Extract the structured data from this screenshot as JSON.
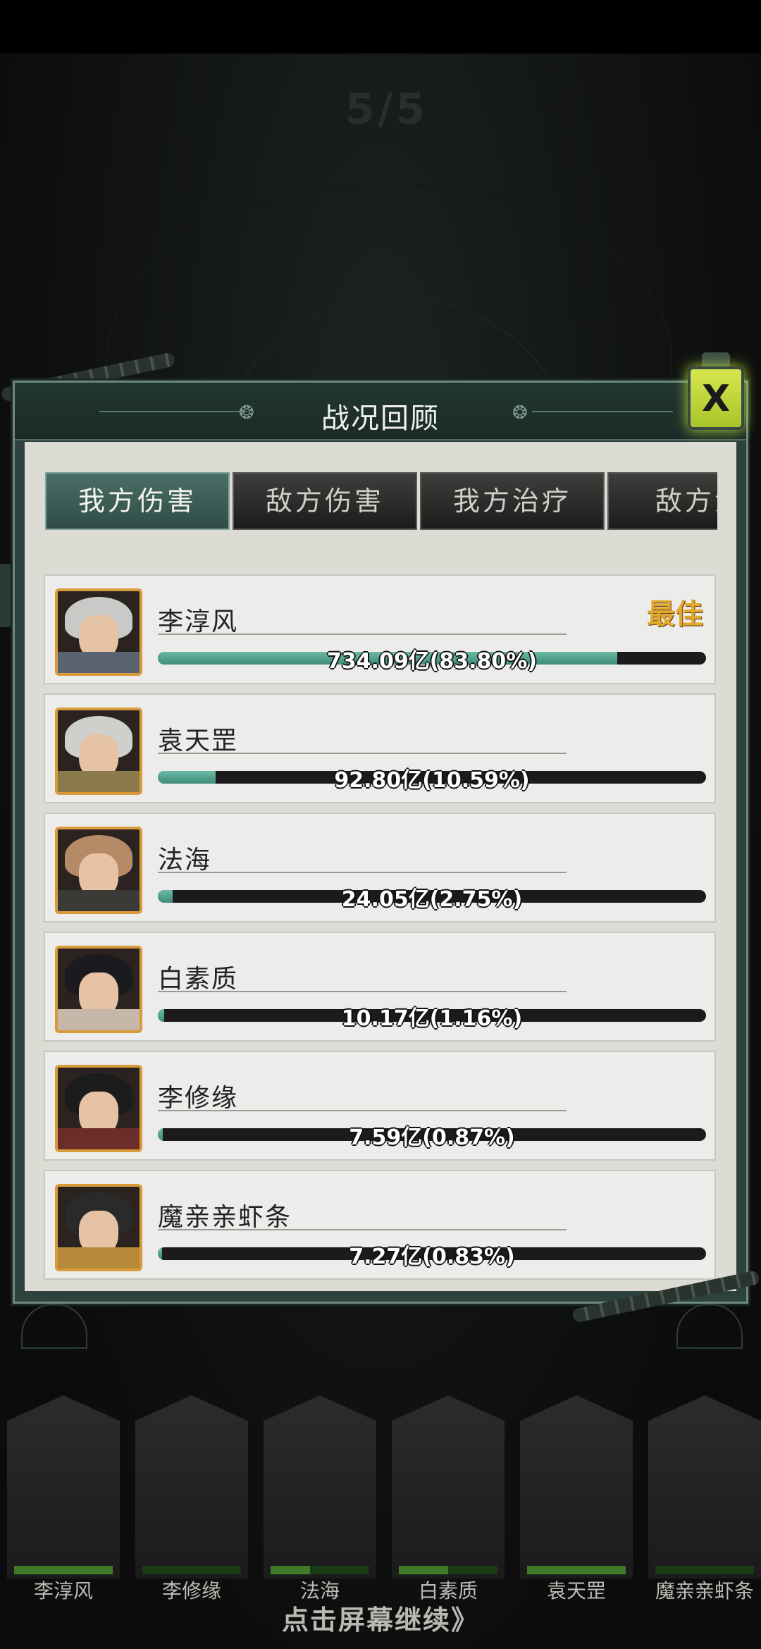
{
  "background": {
    "wave_indicator": "5/5"
  },
  "panel": {
    "title": "战况回顾",
    "close_icon": "X"
  },
  "tabs": [
    "我方伤害",
    "敌方伤害",
    "我方治疗",
    "敌方治"
  ],
  "best_label": "最佳",
  "rows": [
    {
      "name": "李淳风",
      "value_text": "734.09亿(83.80%)",
      "percent": 83.8,
      "hair": "#c9c9c7",
      "body": "#5a6470"
    },
    {
      "name": "袁天罡",
      "value_text": "92.80亿(10.59%)",
      "percent": 10.59,
      "hair": "#cfcfcc",
      "body": "#8a7a4c"
    },
    {
      "name": "法海",
      "value_text": "24.05亿(2.75%)",
      "percent": 2.75,
      "hair": "#b58b67",
      "body": "#3a3a36"
    },
    {
      "name": "白素质",
      "value_text": "10.17亿(1.16%)",
      "percent": 1.16,
      "hair": "#1a1a1f",
      "body": "#c7b7a8"
    },
    {
      "name": "李修缘",
      "value_text": "7.59亿(0.87%)",
      "percent": 0.87,
      "hair": "#1c1c1c",
      "body": "#6b2c2a"
    },
    {
      "name": "魔亲亲虾条",
      "value_text": "7.27亿(0.83%)",
      "percent": 0.83,
      "hair": "#2a2a2a",
      "body": "#b78a3a"
    }
  ],
  "bottom_cards": [
    {
      "name": "李淳风",
      "hp": 1.0
    },
    {
      "name": "李修缘",
      "hp": 0.0
    },
    {
      "name": "法海",
      "hp": 0.4
    },
    {
      "name": "白素质",
      "hp": 0.5
    },
    {
      "name": "袁天罡",
      "hp": 1.0
    },
    {
      "name": "魔亲亲虾条",
      "hp": 0.0
    }
  ],
  "continue_text": "点击屏幕继续》"
}
